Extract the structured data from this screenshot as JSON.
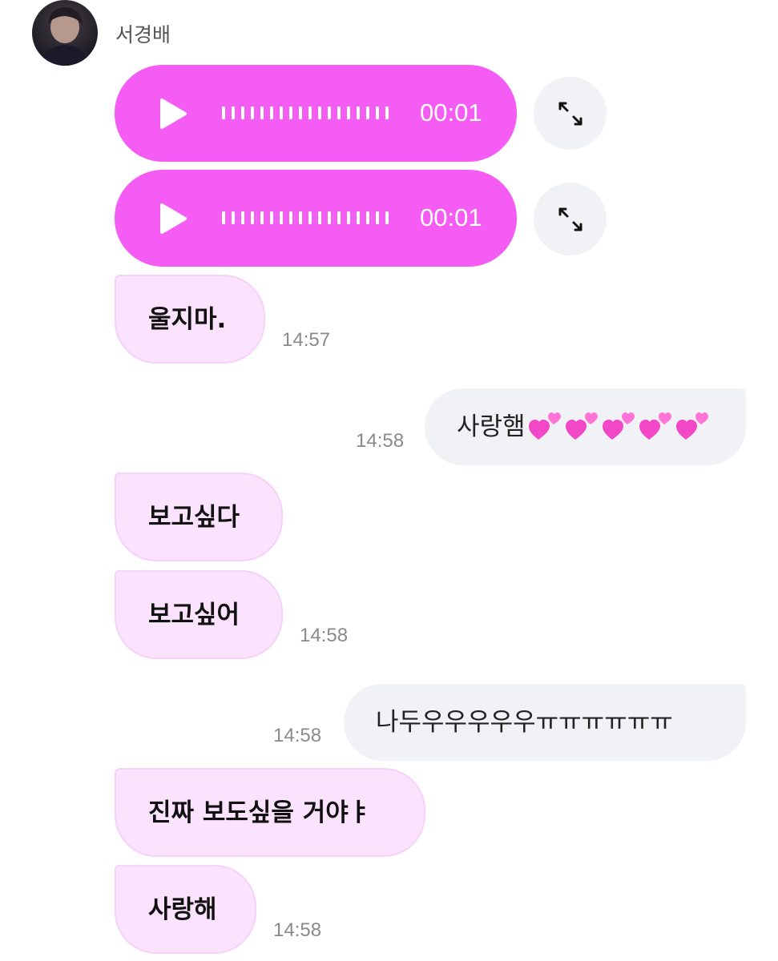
{
  "sender": {
    "name": "서경배"
  },
  "voice_messages": [
    {
      "duration": "00:01"
    },
    {
      "duration": "00:01"
    }
  ],
  "messages": [
    {
      "direction": "in",
      "text": "울지마.",
      "time": "14:57"
    },
    {
      "direction": "out",
      "text": "사랑햄",
      "emoji": [
        "two-hearts-emoji",
        "two-hearts-emoji",
        "two-hearts-emoji",
        "two-hearts-emoji",
        "two-hearts-emoji"
      ],
      "time": "14:58"
    },
    {
      "direction": "in",
      "text": "보고싶다"
    },
    {
      "direction": "in",
      "text": "보고싶어",
      "time": "14:58"
    },
    {
      "direction": "out",
      "text": "나두우우우우우ㅠㅠㅠㅠㅠㅠ",
      "time": "14:58"
    },
    {
      "direction": "in",
      "text": "진짜 보도싶을 거야ㅑ"
    },
    {
      "direction": "in",
      "text": "사랑해",
      "time": "14:58"
    }
  ],
  "colors": {
    "voice_bubble": "#f45cf3",
    "incoming_bubble": "#fbe2fd",
    "outgoing_bubble": "#f1f2f5",
    "timestamp": "#8a8a8a"
  }
}
